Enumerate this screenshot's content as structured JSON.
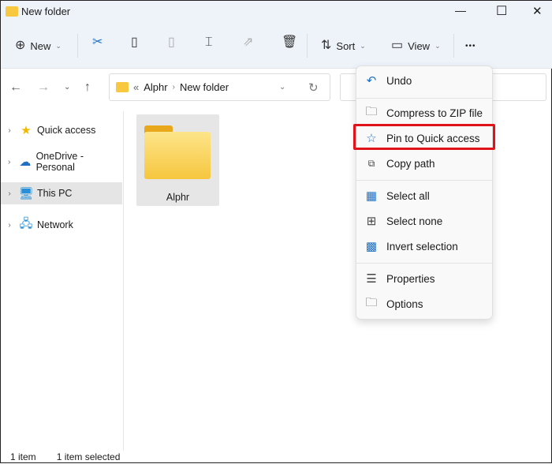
{
  "window": {
    "title": "New folder",
    "controls": {
      "minimize": "—",
      "maximize": "☐",
      "close": "✕"
    }
  },
  "toolbar": {
    "new_label": "New",
    "sort_label": "Sort",
    "view_label": "View",
    "more": "•••",
    "icons": [
      "cut-icon",
      "copy-icon",
      "paste-icon",
      "rename-icon",
      "share-icon",
      "delete-icon"
    ]
  },
  "nav": {
    "breadcrumb": [
      "Alphr",
      "New folder"
    ],
    "overflow": "«"
  },
  "sidebar": {
    "items": [
      {
        "label": "Quick access",
        "icon": "star-icon"
      },
      {
        "label": "OneDrive - Personal",
        "icon": "cloud-icon"
      },
      {
        "label": "This PC",
        "icon": "monitor-icon",
        "selected": true
      },
      {
        "label": "Network",
        "icon": "network-icon"
      }
    ]
  },
  "content": {
    "items": [
      {
        "name": "Alphr",
        "type": "folder",
        "selected": true
      }
    ]
  },
  "status": {
    "count": "1 item",
    "selected": "1 item selected"
  },
  "context_menu": {
    "items": [
      {
        "label": "Undo",
        "icon": "undo-icon"
      },
      {
        "label": "Compress to ZIP file",
        "icon": "zip-icon"
      },
      {
        "label": "Pin to Quick access",
        "icon": "star-icon",
        "highlighted": true
      },
      {
        "label": "Copy path",
        "icon": "copy-path-icon"
      },
      {
        "label": "Select all",
        "icon": "select-all-icon"
      },
      {
        "label": "Select none",
        "icon": "select-none-icon"
      },
      {
        "label": "Invert selection",
        "icon": "invert-selection-icon"
      },
      {
        "label": "Properties",
        "icon": "properties-icon"
      },
      {
        "label": "Options",
        "icon": "options-icon"
      }
    ]
  },
  "colors": {
    "accent": "#1f6fc2",
    "highlight_box": "#e0131b",
    "folder": "#f8c840"
  }
}
